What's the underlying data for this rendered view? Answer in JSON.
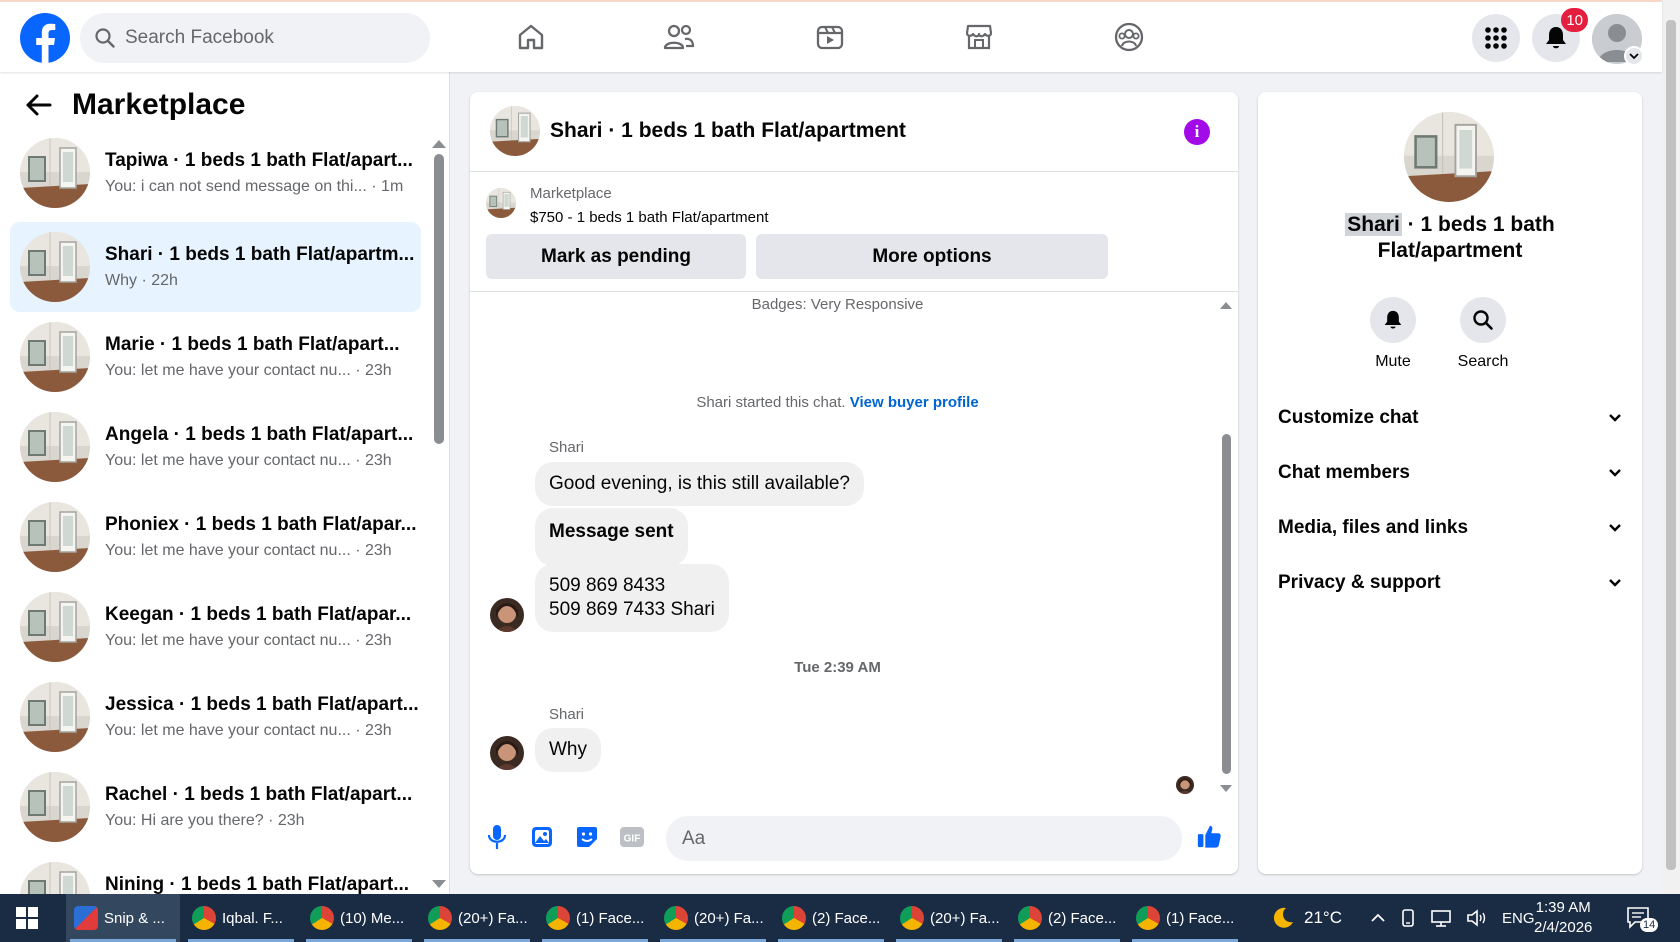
{
  "topbar": {
    "logo": "facebook-logo",
    "search_placeholder": "Search Facebook",
    "nav": [
      "home-icon",
      "friends-icon",
      "watch-icon",
      "marketplace-icon",
      "groups-icon"
    ],
    "notification_count": "10"
  },
  "sidebar": {
    "title": "Marketplace",
    "conversations": [
      {
        "title": "Tapiwa · 1 beds 1 bath Flat/apart...",
        "preview": "You: i can not send message on thi...",
        "time": "· 1m"
      },
      {
        "title": "Shari · 1 beds 1 bath Flat/apartm...",
        "preview": "Why",
        "time": "· 22h"
      },
      {
        "title": "Marie · 1 beds 1 bath Flat/apart...",
        "preview": "You: let me have your contact nu...",
        "time": "· 23h"
      },
      {
        "title": "Angela · 1 beds 1 bath Flat/apart...",
        "preview": "You: let me have your contact nu...",
        "time": "· 23h"
      },
      {
        "title": "Phoniex · 1 beds 1 bath Flat/apar...",
        "preview": "You: let me have your contact nu...",
        "time": "· 23h"
      },
      {
        "title": "Keegan · 1 beds 1 bath Flat/apar...",
        "preview": "You: let me have your contact nu...",
        "time": "· 23h"
      },
      {
        "title": "Jessica · 1 beds 1 bath Flat/apart...",
        "preview": "You: let me have your contact nu...",
        "time": "· 23h"
      },
      {
        "title": "Rachel · 1 beds 1 bath Flat/apart...",
        "preview": "You: Hi are you there?",
        "time": "· 23h"
      },
      {
        "title": "Nining · 1 beds 1 bath Flat/apart...",
        "preview": "",
        "time": ""
      }
    ]
  },
  "chat": {
    "title": "Shari · 1 beds 1 bath Flat/apartment",
    "listing_source": "Marketplace",
    "listing_price": "$750 - 1 beds 1 bath Flat/apartment",
    "mark_pending_label": "Mark as pending",
    "more_options_label": "More options",
    "badges": "Badges: Very Responsive",
    "started_text": "Shari started this chat.",
    "view_profile_link": "View buyer profile",
    "sender_name": "Shari",
    "messages_group1": [
      "Good evening, is this still available?",
      "Message sent",
      "509 869 8433",
      "509 869 7433 Shari"
    ],
    "timestamp": "Tue 2:39 AM",
    "messages_group2": [
      "Why"
    ],
    "input_placeholder": "Aa"
  },
  "details": {
    "name_highlight": "Shari",
    "name_rest": " · 1 beds 1 bath",
    "name_line2": "Flat/apartment",
    "mute_label": "Mute",
    "search_label": "Search",
    "sections": [
      "Customize chat",
      "Chat members",
      "Media, files and links",
      "Privacy & support"
    ]
  },
  "taskbar": {
    "tasks": [
      "Snip & ...",
      "Iqbal. F...",
      "(10) Me...",
      "(20+) Fa...",
      "(1) Face...",
      "(20+) Fa...",
      "(2) Face...",
      "(20+) Fa...",
      "(2) Face...",
      "(1) Face..."
    ],
    "temperature": "21°C",
    "language": "ENG",
    "time": "1:39 AM",
    "date": "2/4/2026",
    "notification_count": "14"
  },
  "colors": {
    "brand": "#0866ff",
    "accent_purple": "#a30ae8",
    "active_row": "#e7f3ff",
    "badge_red": "#e41e3f"
  }
}
